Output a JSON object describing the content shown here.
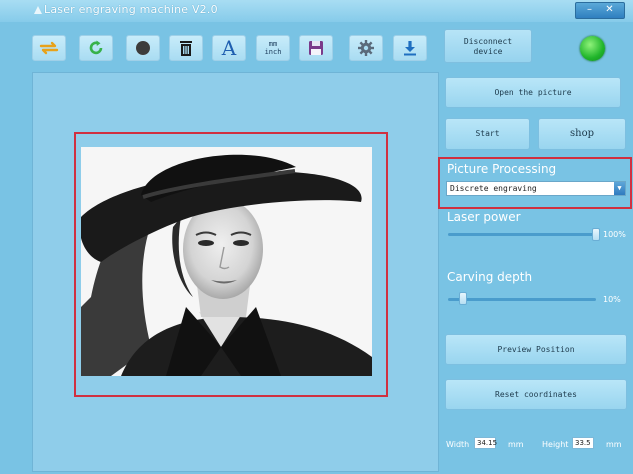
{
  "window": {
    "title": "Laser engraving machine V2.0",
    "minimize_glyph": "–",
    "close_glyph": "✕"
  },
  "toolbar": {
    "tools": [
      {
        "name": "swap-icon"
      },
      {
        "name": "refresh-icon"
      },
      {
        "name": "invert-icon"
      },
      {
        "name": "delete-icon"
      },
      {
        "name": "text-icon",
        "glyph": "A"
      },
      {
        "name": "unit-icon",
        "glyph_top": "mm",
        "glyph_bottom": "inch"
      },
      {
        "name": "save-icon"
      },
      {
        "name": "settings-icon"
      },
      {
        "name": "download-icon"
      }
    ],
    "disconnect_label_1": "Disconnect",
    "disconnect_label_2": "device",
    "status_color": "#20b52b"
  },
  "side": {
    "open_picture": "Open the picture",
    "start": "Start",
    "shop": "shop",
    "picture_processing": "Picture Processing",
    "processing_mode": "Discrete engraving",
    "laser_power_label": "Laser power",
    "laser_power_value": "100%",
    "laser_power_fraction": 1.0,
    "carving_depth_label": "Carving depth",
    "carving_depth_value": "10%",
    "carving_depth_fraction": 0.1,
    "preview_position": "Preview Position",
    "reset_coordinates": "Reset coordinates",
    "width_label": "Width",
    "width_value": "34.15",
    "width_unit": "mm",
    "height_label": "Height",
    "height_value": "33.5",
    "height_unit": "mm"
  },
  "colors": {
    "accent": "#79c3e4",
    "highlight": "#d03040"
  }
}
